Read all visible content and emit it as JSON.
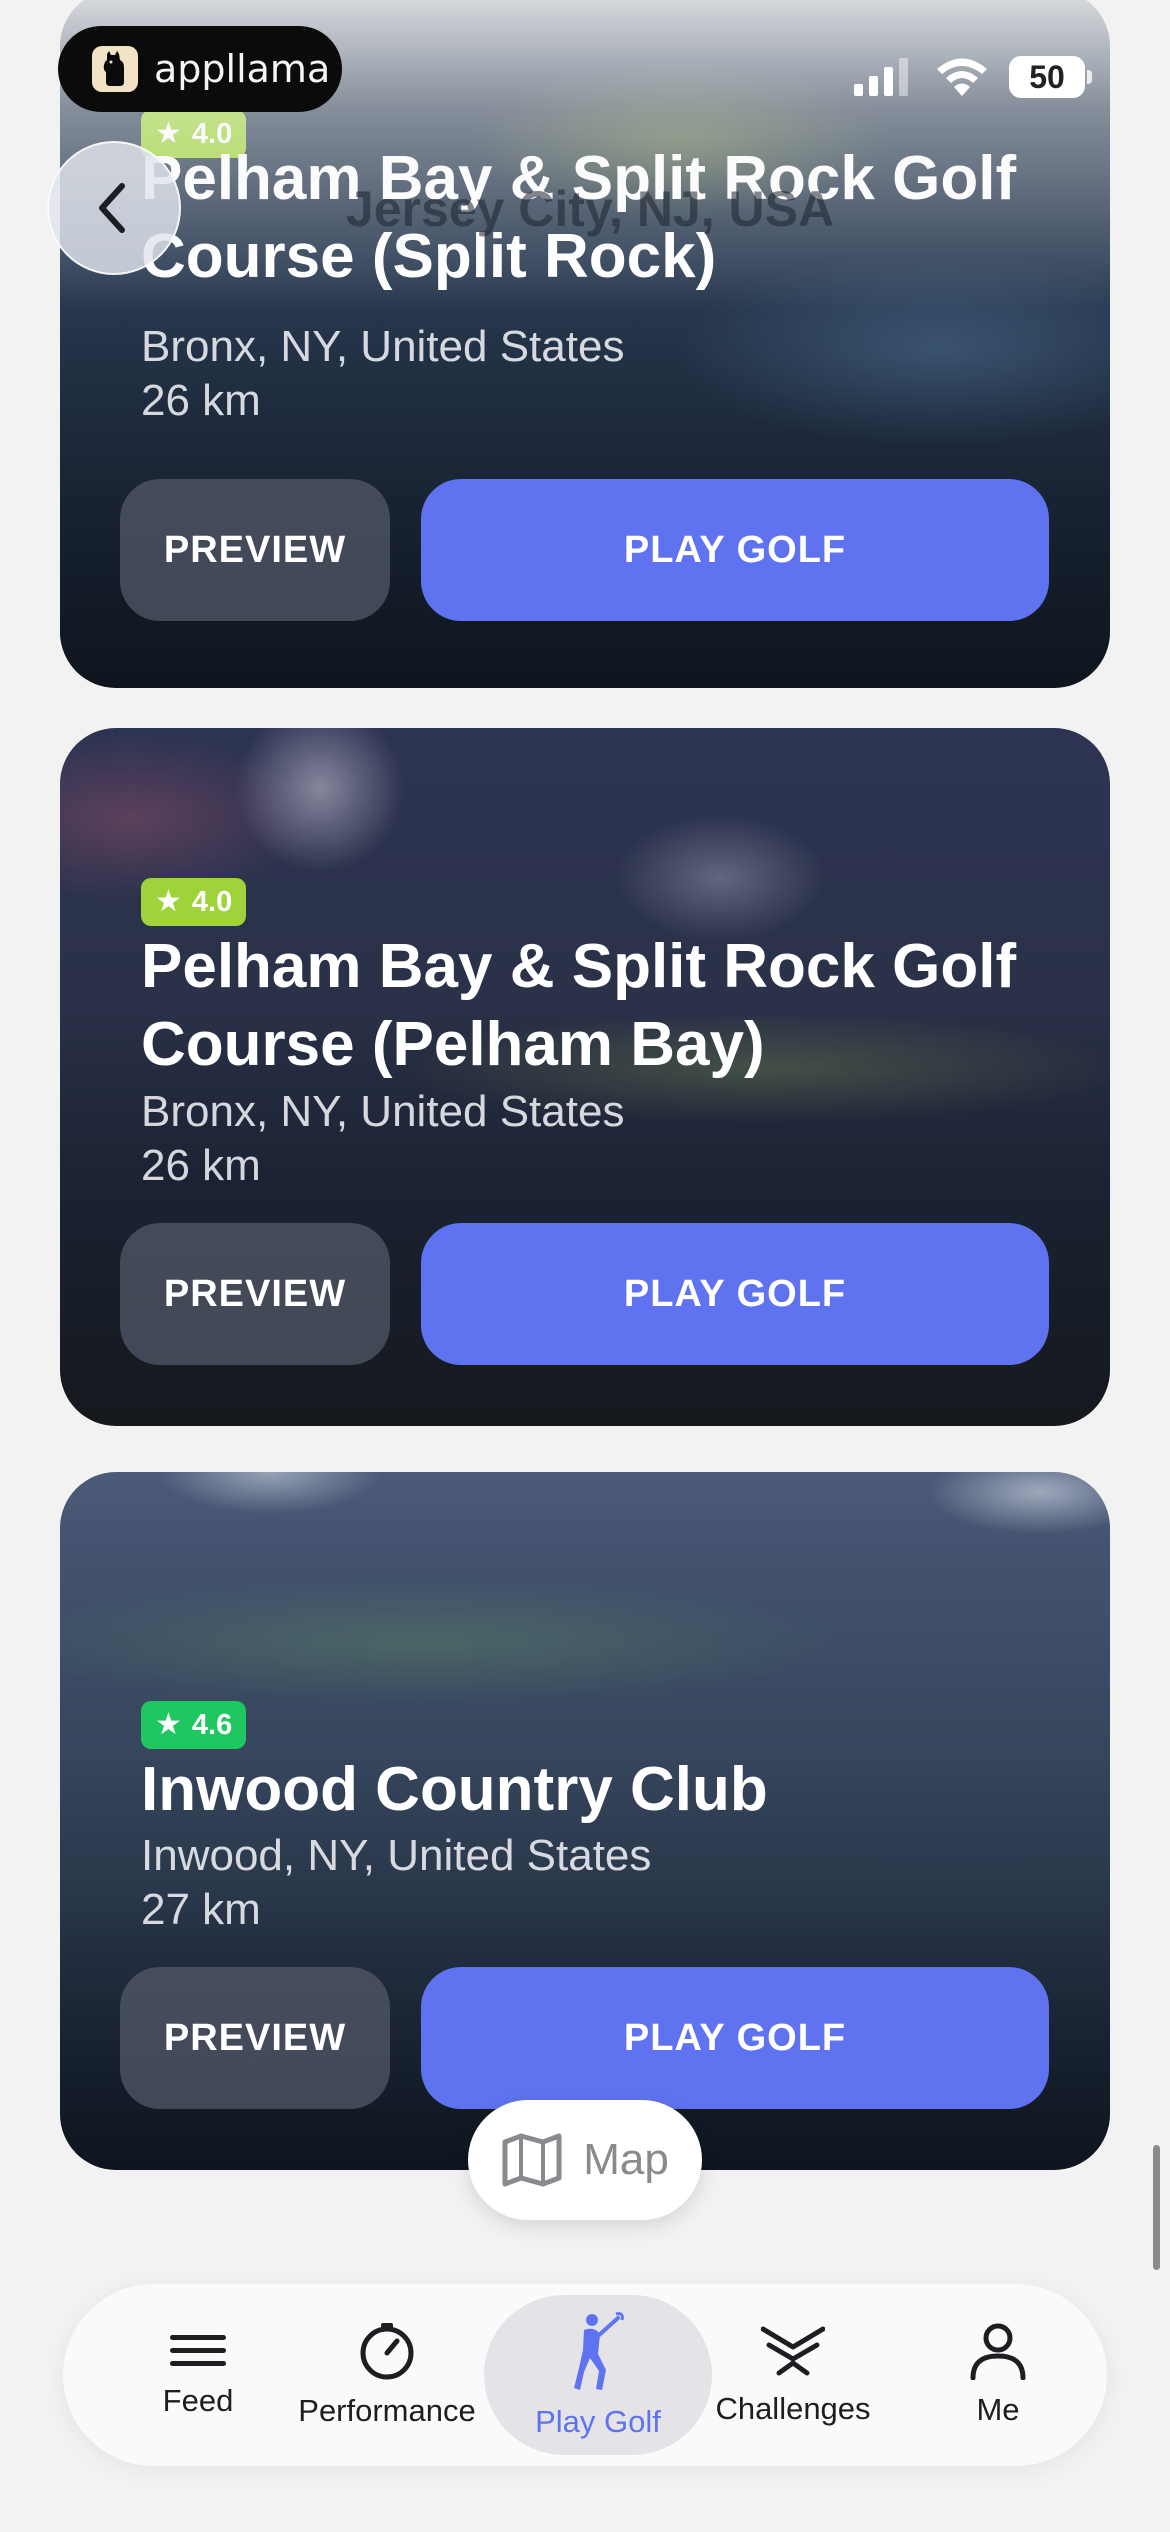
{
  "status_bar": {
    "app_brand": "appllama",
    "battery": "50"
  },
  "header": {
    "title": "Jersey City, NJ, USA"
  },
  "cards": [
    {
      "rating": "4.0",
      "title": "Pelham Bay & Split Rock Golf Course (Split Rock)",
      "location": "Bronx, NY, United States",
      "distance": "26 km",
      "preview_label": "PREVIEW",
      "play_label": "PLAY GOLF"
    },
    {
      "rating": "4.0",
      "title": "Pelham Bay & Split Rock Golf Course (Pelham Bay)",
      "location": "Bronx, NY, United States",
      "distance": "26 km",
      "preview_label": "PREVIEW",
      "play_label": "PLAY GOLF"
    },
    {
      "rating": "4.6",
      "title": "Inwood Country Club",
      "location": "Inwood, NY, United States",
      "distance": "27 km",
      "preview_label": "PREVIEW",
      "play_label": "PLAY GOLF"
    }
  ],
  "map_button": {
    "label": "Map",
    "icon": "map-icon"
  },
  "tabbar": {
    "active": "play-golf",
    "items": [
      {
        "label": "Feed",
        "icon": "menu-lines-icon"
      },
      {
        "label": "Performance",
        "icon": "gauge-icon"
      },
      {
        "label": "Play Golf",
        "icon": "golfer-icon"
      },
      {
        "label": "Challenges",
        "icon": "chevrons-icon"
      },
      {
        "label": "Me",
        "icon": "person-icon"
      }
    ]
  },
  "colors": {
    "accent": "#5f73f0",
    "rating_4_0": "#9ed43a",
    "rating_4_6": "#1ec760",
    "page_bg": "#f2f2f3"
  }
}
